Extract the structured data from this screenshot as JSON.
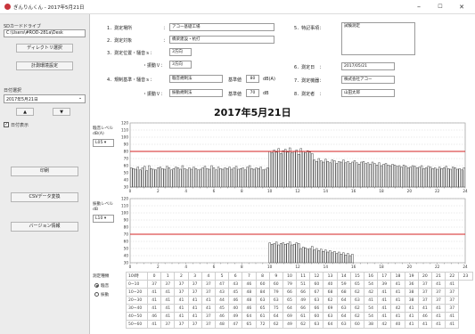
{
  "window": {
    "title": "ぎんりんくん - 2017年5月21日",
    "min": "–",
    "max": "☐",
    "close": "✕"
  },
  "left": {
    "sd_label": "SDカードドライブ",
    "path": "C:\\Users\\#ROD-281a\\Desk",
    "dir_button": "ディレクトリ選択",
    "settings_button": "計測環境設定",
    "date_label": "日付選択",
    "date_value": "2017年5月21日",
    "prev": "▲",
    "next": "▼",
    "show_checkbox_label": "日付表示",
    "print_button": "印刷",
    "csv_button": "CSVデータ変換",
    "version_button": "バージョン情報"
  },
  "form": {
    "l1": "1．測定場所",
    "v1": "アコー基礎工場",
    "l2": "2．測定対象",
    "v2": "橋梁建設・杭打",
    "l3": "3．測定位置・騒音ｓ：",
    "v3": "3方向",
    "l3b": "・振動Ｖ：",
    "v3b": "3方向",
    "l4": "4．規制基準・騒音ｓ：",
    "v4": "騒音規制法",
    "l4_std_label": "基準値",
    "v4_std": "80",
    "v4_unit": "dB(A)",
    "l4b": "・振動Ｖ：",
    "v4b": "振動規制法",
    "l4b_std_label": "基準値",
    "v4b_std": "70",
    "v4b_unit": "dB",
    "l5": "5．特記事項：",
    "v5": "試験測定",
    "l6": "6．測定日　：",
    "v6": "2017/05/21",
    "l7": "7．測定機器：",
    "v7": "株式会社アコー",
    "l8": "8．測定者　：",
    "v8": "山田太郎"
  },
  "date_heading": "2017年5月21日",
  "charts": {
    "noise": {
      "label": "騒音レベル",
      "unit": "dB(A)",
      "select": "L05 ▾",
      "yticks": [
        "120",
        "110",
        "100",
        "90",
        "80",
        "70",
        "60",
        "50",
        "40",
        "30"
      ]
    },
    "vib": {
      "label": "振動レベル",
      "unit": "dB",
      "select": "L10 ▾",
      "yticks": [
        "120",
        "110",
        "100",
        "90",
        "80",
        "70",
        "60",
        "50",
        "40",
        "30"
      ]
    },
    "xticks": [
      "0",
      "2",
      "4",
      "6",
      "8",
      "10",
      "12",
      "14",
      "16",
      "18",
      "20",
      "22",
      "24"
    ]
  },
  "chart_data": [
    {
      "type": "bar",
      "title": "騒音レベル",
      "ylabel": "dB(A)",
      "ylim": [
        30,
        120
      ],
      "xlim": [
        0,
        24
      ],
      "limit": 80,
      "values": [
        57,
        56,
        55,
        58,
        54,
        57,
        59,
        53,
        60,
        56,
        55,
        54,
        57,
        58,
        56,
        55,
        59,
        57,
        54,
        56,
        58,
        57,
        55,
        60,
        56,
        54,
        57,
        55,
        58,
        56,
        54,
        55,
        57,
        59,
        56,
        55,
        60,
        57,
        54,
        58,
        56,
        55,
        57,
        56,
        58,
        55,
        57,
        59,
        55,
        56,
        57,
        54,
        58,
        60,
        56,
        55,
        57,
        56,
        58,
        54,
        55,
        57,
        80,
        78,
        82,
        79,
        84,
        77,
        81,
        83,
        79,
        85,
        78,
        80,
        82,
        76,
        84,
        80,
        78,
        81,
        79,
        77,
        68,
        66,
        70,
        67,
        65,
        69,
        66,
        64,
        68,
        67,
        63,
        66,
        65,
        68,
        64,
        66,
        63,
        65,
        67,
        64,
        62,
        65,
        66,
        63,
        64,
        62,
        65,
        63,
        61,
        64,
        60,
        62,
        63,
        61,
        60,
        62,
        61,
        59,
        60,
        58,
        61,
        59,
        57,
        58,
        60,
        59,
        57,
        58,
        60,
        56,
        57,
        59,
        58,
        56,
        57,
        55,
        58,
        56,
        57,
        59,
        56,
        55,
        58,
        57,
        55,
        56,
        54,
        57
      ]
    },
    {
      "type": "bar",
      "title": "振動レベル",
      "ylabel": "dB",
      "ylim": [
        30,
        120
      ],
      "xlim": [
        0,
        24
      ],
      "limit": 70,
      "values": [
        0,
        0,
        0,
        0,
        0,
        0,
        0,
        0,
        0,
        0,
        0,
        0,
        0,
        0,
        0,
        0,
        0,
        0,
        0,
        0,
        0,
        0,
        0,
        0,
        0,
        0,
        0,
        0,
        0,
        0,
        0,
        0,
        0,
        0,
        0,
        0,
        0,
        0,
        0,
        0,
        0,
        0,
        0,
        0,
        0,
        0,
        0,
        0,
        0,
        0,
        0,
        0,
        0,
        0,
        0,
        0,
        0,
        0,
        0,
        0,
        0,
        0,
        58,
        56,
        57,
        59,
        55,
        57,
        58,
        56,
        57,
        59,
        55,
        56,
        58,
        57,
        50,
        52,
        51,
        49,
        50,
        53,
        48,
        50,
        47,
        49,
        46,
        48,
        45,
        47,
        44,
        46,
        43,
        45,
        42,
        44,
        41,
        43,
        40,
        42,
        0,
        0,
        0,
        0,
        0,
        0,
        0,
        0,
        0,
        0,
        0,
        0,
        0,
        0,
        0,
        0,
        0,
        0,
        0,
        0,
        0,
        0,
        0,
        0,
        0,
        0,
        0,
        0,
        0,
        0,
        0,
        0,
        0,
        0,
        0,
        0,
        0,
        0,
        0,
        0,
        0,
        0,
        0,
        0,
        0,
        0,
        0,
        0,
        0,
        0
      ]
    }
  ],
  "table": {
    "mode_label": "測定種類",
    "radio_noise": "騒音",
    "radio_vib": "振動",
    "header": [
      "10\\時",
      "0",
      "1",
      "2",
      "3",
      "4",
      "5",
      "6",
      "7",
      "8",
      "9",
      "10",
      "11",
      "12",
      "13",
      "14",
      "15",
      "16",
      "17",
      "18",
      "19",
      "20",
      "21",
      "22",
      "23"
    ],
    "rows": [
      [
        "0~10",
        "37",
        "37",
        "37",
        "37",
        "37",
        "47",
        "43",
        "46",
        "60",
        "60",
        "79",
        "51",
        "60",
        "40",
        "59",
        "65",
        "54",
        "39",
        "41",
        "36",
        "37",
        "41",
        "41"
      ],
      [
        "10~20",
        "41",
        "41",
        "37",
        "37",
        "37",
        "43",
        "45",
        "48",
        "84",
        "79",
        "66",
        "66",
        "67",
        "68",
        "68",
        "62",
        "42",
        "41",
        "41",
        "38",
        "37",
        "37",
        "37"
      ],
      [
        "20~30",
        "41",
        "41",
        "41",
        "41",
        "41",
        "44",
        "46",
        "48",
        "63",
        "63",
        "65",
        "49",
        "63",
        "62",
        "64",
        "63",
        "41",
        "41",
        "41",
        "38",
        "37",
        "37",
        "37"
      ],
      [
        "30~40",
        "41",
        "41",
        "41",
        "41",
        "41",
        "45",
        "40",
        "46",
        "65",
        "75",
        "64",
        "66",
        "66",
        "69",
        "63",
        "62",
        "54",
        "41",
        "42",
        "41",
        "41",
        "41",
        "37"
      ],
      [
        "40~50",
        "46",
        "41",
        "41",
        "41",
        "37",
        "46",
        "49",
        "64",
        "61",
        "64",
        "69",
        "61",
        "60",
        "63",
        "64",
        "62",
        "54",
        "41",
        "41",
        "41",
        "46",
        "41",
        "41"
      ],
      [
        "50~60",
        "41",
        "37",
        "37",
        "37",
        "37",
        "48",
        "47",
        "65",
        "72",
        "62",
        "49",
        "62",
        "63",
        "64",
        "63",
        "60",
        "38",
        "42",
        "40",
        "41",
        "41",
        "41",
        "41"
      ]
    ]
  }
}
